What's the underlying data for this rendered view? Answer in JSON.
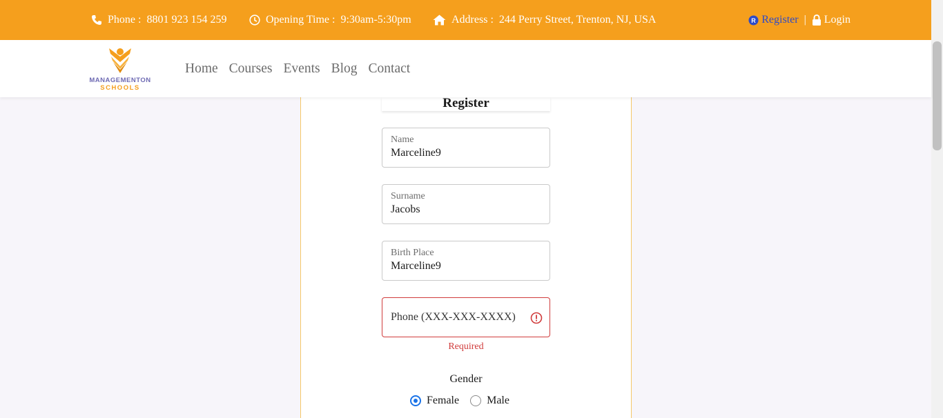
{
  "topbar": {
    "phone_label": "Phone :",
    "phone_value": "8801 923 154 259",
    "hours_label": "Opening Time :",
    "hours_value": "9:30am-5:30pm",
    "address_label": "Address :",
    "address_value": "244 Perry Street, Trenton, NJ, USA",
    "register": "Register",
    "separator": "|",
    "login": "Login"
  },
  "logo": {
    "line1": "MANAGEMENTON",
    "line2": "SCHOOLS"
  },
  "nav": {
    "items": [
      "Home",
      "Courses",
      "Events",
      "Blog",
      "Contact"
    ]
  },
  "form": {
    "title": "Register",
    "name_label": "Name",
    "name_value": "Marceline9",
    "surname_label": "Surname",
    "surname_value": "Jacobs",
    "birthplace_label": "Birth Place",
    "birthplace_value": "Marceline9",
    "phone_placeholder": "Phone (XXX-XXX-XXXX)",
    "phone_error": "Required",
    "gender_label": "Gender",
    "gender_options": [
      "Female",
      "Male"
    ],
    "gender_selected": "Female"
  },
  "colors": {
    "accent": "#f59f1d",
    "link": "#2e4ac7",
    "error": "#d03b3b",
    "radio": "#1a73e8"
  }
}
